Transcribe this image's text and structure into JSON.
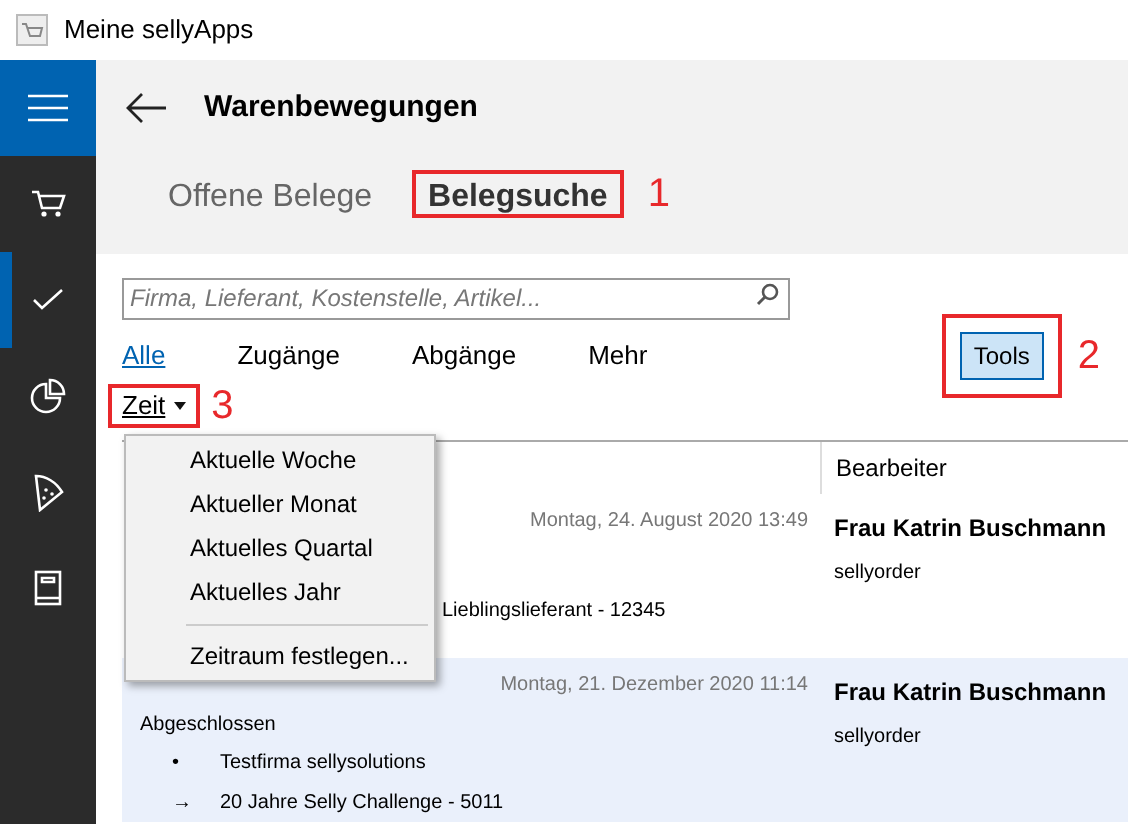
{
  "window": {
    "title": "Meine sellyApps"
  },
  "sidebar": {
    "items": [
      {
        "kind": "cart",
        "selected": false
      },
      {
        "kind": "check",
        "selected": true
      },
      {
        "kind": "pie",
        "selected": false
      },
      {
        "kind": "pizza",
        "selected": false
      },
      {
        "kind": "book",
        "selected": false
      }
    ]
  },
  "header": {
    "title": "Warenbewegungen"
  },
  "tabs": [
    {
      "label": "Offene Belege",
      "selected": false
    },
    {
      "label": "Belegsuche",
      "selected": true,
      "annotation": "1"
    }
  ],
  "search": {
    "placeholder": "Firma, Lieferant, Kostenstelle, Artikel..."
  },
  "filters": [
    {
      "label": "Alle",
      "selected": true
    },
    {
      "label": "Zugänge",
      "selected": false
    },
    {
      "label": "Abgänge",
      "selected": false
    },
    {
      "label": "Mehr",
      "selected": false
    }
  ],
  "tools_button": {
    "label": "Tools",
    "annotation": "2"
  },
  "time_dropdown": {
    "label": "Zeit",
    "annotation": "3"
  },
  "table": {
    "columns": [
      "Bearbeiter"
    ],
    "rows": [
      {
        "date": "Montag, 24. August 2020 13:49",
        "lines": [
          {
            "text": "Lieblingslieferant - 12345"
          }
        ],
        "editor": "Frau Katrin Buschmann",
        "editor_sub": "sellyorder",
        "selected": false
      },
      {
        "date": "Montag, 21. Dezember 2020 11:14",
        "status": "Abgeschlossen",
        "lines": [
          {
            "marker": "•",
            "text": "Testfirma sellysolutions"
          },
          {
            "marker": "→",
            "text": "20 Jahre Selly Challenge - 5011"
          }
        ],
        "editor": "Frau Katrin Buschmann",
        "editor_sub": "sellyorder",
        "selected": true
      }
    ]
  },
  "time_menu": {
    "items": [
      {
        "label": "Aktuelle Woche",
        "kind": "option"
      },
      {
        "label": "Aktueller Monat",
        "kind": "option"
      },
      {
        "label": "Aktuelles Quartal",
        "kind": "option"
      },
      {
        "label": "Aktuelles Jahr",
        "kind": "option"
      },
      {
        "kind": "separator"
      },
      {
        "label": "Zeitraum festlegen...",
        "kind": "option"
      }
    ]
  }
}
